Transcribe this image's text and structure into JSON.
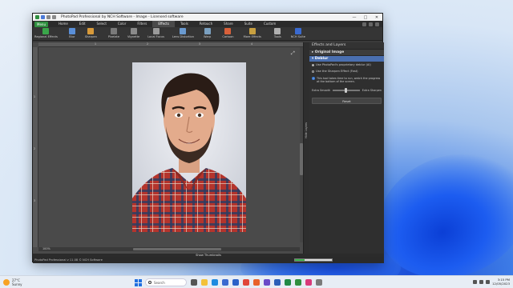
{
  "window": {
    "title": "PhotoPad Professional by NCH Software - Image - Licensed software",
    "controls": [
      "—",
      "□",
      "✕"
    ]
  },
  "menu": {
    "button_label": "Menu",
    "tabs": [
      "Home",
      "Edit",
      "Select",
      "Color",
      "Filters",
      "Effects",
      "Tools",
      "Retouch",
      "Share",
      "Suite",
      "Custom"
    ],
    "active_tab": "Effects"
  },
  "ribbon": {
    "tools": [
      {
        "label": "Regional Effects",
        "icon": "regional-effects-icon",
        "color": "#3aa64a"
      },
      {
        "label": "Blur",
        "icon": "blur-icon",
        "color": "#5a8fd8"
      },
      {
        "label": "Sharpen",
        "icon": "sharpen-icon",
        "color": "#d89a3a"
      },
      {
        "label": "Pixelate",
        "icon": "pixelate-icon",
        "color": "#7a7a7a"
      },
      {
        "label": "Vignette",
        "icon": "vignette-icon",
        "color": "#8a8a8a"
      },
      {
        "label": "Local Focus",
        "icon": "local-focus-icon",
        "color": "#9a9a9a"
      },
      {
        "label": "Lens Distortion",
        "icon": "lens-distortion-icon",
        "color": "#6a9ad0"
      },
      {
        "label": "Warp",
        "icon": "warp-icon",
        "color": "#7aa0c0"
      },
      {
        "label": "Cartoon",
        "icon": "cartoon-icon",
        "color": "#d8603a"
      },
      {
        "label": "More Effects",
        "icon": "more-effects-icon",
        "color": "#c8a040"
      },
      {
        "label": "Tools",
        "icon": "tools-icon",
        "color": "#b0b0b0"
      },
      {
        "label": "NCH Suite",
        "icon": "nch-suite-icon",
        "color": "#3a6ad0"
      }
    ]
  },
  "canvas": {
    "ruler_ticks": [
      "1",
      "2",
      "3",
      "4",
      "5"
    ],
    "zoom_label": "100%"
  },
  "side_tab": {
    "label": "Hide Layers"
  },
  "panel": {
    "title": "Effects and Layers",
    "original_image": "Original Image",
    "active_effect": "Deblur",
    "options": [
      {
        "label": "Use PhotoPad's proprietary deblur (AI)",
        "selected": true
      },
      {
        "label": "Use the Sharpen Effect (Fast)",
        "selected": false
      }
    ],
    "info_text": "This tool takes time to run, watch the progress at the bottom of the screen.",
    "slider": {
      "left_label": "Extra Smooth",
      "right_label": "Extra Sharpen",
      "value_fraction": 0.45
    },
    "reset_label": "Reset"
  },
  "bottom": {
    "show_thumbnails": "Show Thumbnails",
    "status_text": "PhotoPad Professional v 11.08 © NCH Software",
    "progress_fraction": 0.25
  },
  "taskbar": {
    "weather_temp": "27°C",
    "weather_desc": "Sunny",
    "search_placeholder": "Search",
    "time": "3:15 PM",
    "date": "12/05/2023",
    "apps": [
      {
        "icon": "task-view-icon",
        "color": "#555555"
      },
      {
        "icon": "file-explorer-icon",
        "color": "#f3c13a"
      },
      {
        "icon": "edge-icon",
        "color": "#1f8be0"
      },
      {
        "icon": "store-icon",
        "color": "#3a6ad0"
      },
      {
        "icon": "mail-icon",
        "color": "#2a62c8"
      },
      {
        "icon": "chrome-icon",
        "color": "#e0463a"
      },
      {
        "icon": "brave-icon",
        "color": "#e8622a"
      },
      {
        "icon": "photos-icon",
        "color": "#6a4ac8"
      },
      {
        "icon": "word-icon",
        "color": "#2b5fb8"
      },
      {
        "icon": "excel-icon",
        "color": "#1f8a46"
      },
      {
        "icon": "photopad-icon",
        "color": "#2f8f3f"
      },
      {
        "icon": "media-icon",
        "color": "#d83a7a"
      },
      {
        "icon": "settings-icon",
        "color": "#7a7a7a"
      }
    ]
  }
}
